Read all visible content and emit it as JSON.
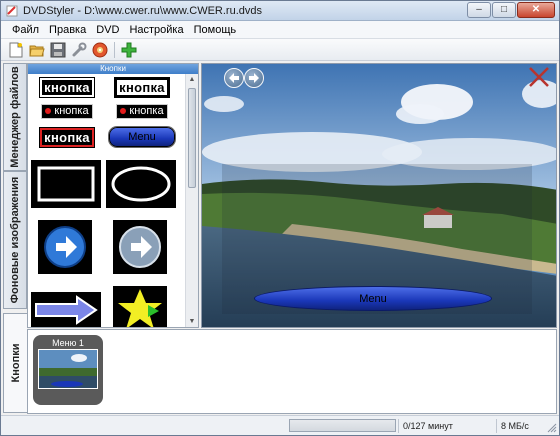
{
  "window": {
    "title": "DVDStyler - D:\\www.cwer.ru\\www.CWER.ru.dvds",
    "minimize_glyph": "–",
    "maximize_glyph": "□",
    "close_glyph": "✕"
  },
  "menubar": {
    "items": [
      "Файл",
      "Правка",
      "DVD",
      "Настройка",
      "Помощь"
    ]
  },
  "toolbar": {
    "icons": [
      "new-document-icon",
      "open-folder-icon",
      "save-icon",
      "settings-wrench-icon",
      "burn-disc-icon",
      "add-plus-icon"
    ]
  },
  "vtabs": {
    "file_manager": "Менеджер файлов",
    "backgrounds": "Фоновые изображения",
    "buttons": "Кнопки"
  },
  "palette": {
    "header": "Кнопки",
    "text_button_1": "кнопка",
    "text_button_2": "кнопка",
    "dot_button_1": "кнопка",
    "dot_button_2": "кнопка",
    "framed_button": "кнопка",
    "menu_button": "Menu"
  },
  "preview": {
    "menu_button_label": "Menu"
  },
  "menus_strip": {
    "menu_thumb_label": "Меню 1"
  },
  "statusbar": {
    "duration": "0/127 минут",
    "rate": "8 МБ/с"
  },
  "colors": {
    "accent_blue": "#3f7ec9",
    "menu_button_blue": "#1a37b8",
    "close_x_red": "#b8342e"
  }
}
